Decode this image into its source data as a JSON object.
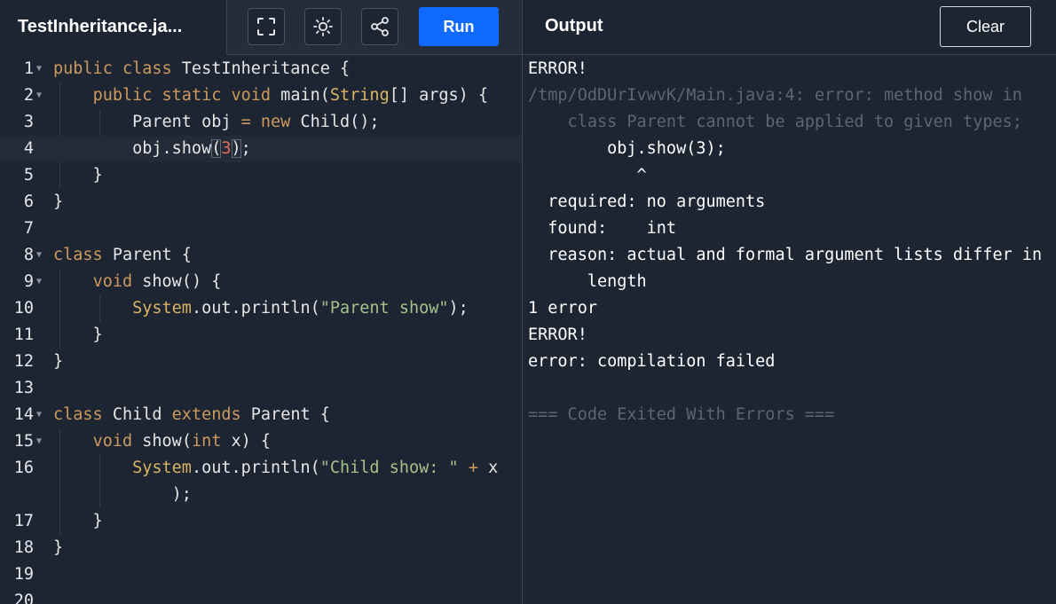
{
  "header": {
    "filename": "TestInheritance.ja...",
    "run_label": "Run",
    "output_title": "Output",
    "clear_label": "Clear",
    "icons": [
      "fullscreen-icon",
      "sun-icon",
      "share-icon"
    ]
  },
  "colors": {
    "background": "#1d2432",
    "run_button": "#0f6bff",
    "keyword": "#cc9a5d",
    "string": "#a5c28b",
    "number": "#e06c5a"
  },
  "editor": {
    "line_numbers": [
      "1",
      "2",
      "3",
      "4",
      "5",
      "6",
      "7",
      "8",
      "9",
      "10",
      "11",
      "12",
      "13",
      "14",
      "15",
      "16",
      "17",
      "18",
      "19",
      "20"
    ],
    "active_line": "4",
    "lines": [
      [
        {
          "t": "public class",
          "c": "kw"
        },
        {
          "t": " TestInheritance {"
        }
      ],
      [
        {
          "t": "    "
        },
        {
          "t": "public static void",
          "c": "kw"
        },
        {
          "t": " main("
        },
        {
          "t": "String",
          "c": "ty"
        },
        {
          "t": "[] args) {"
        }
      ],
      [
        {
          "t": "        Parent obj "
        },
        {
          "t": "=",
          "c": "kw"
        },
        {
          "t": " "
        },
        {
          "t": "new",
          "c": "kw"
        },
        {
          "t": " Child();"
        }
      ],
      [
        {
          "t": "        obj.show"
        },
        {
          "t": "(",
          "c": "br"
        },
        {
          "t": "3",
          "c": "num"
        },
        {
          "t": ")",
          "c": "br"
        },
        {
          "t": ";"
        }
      ],
      [
        {
          "t": "    }"
        }
      ],
      [
        {
          "t": "}"
        }
      ],
      [
        {
          "t": ""
        }
      ],
      [
        {
          "t": "class",
          "c": "kw"
        },
        {
          "t": " Parent {"
        }
      ],
      [
        {
          "t": "    "
        },
        {
          "t": "void",
          "c": "kw"
        },
        {
          "t": " show() {"
        }
      ],
      [
        {
          "t": "        "
        },
        {
          "t": "System",
          "c": "ty"
        },
        {
          "t": ".out.println("
        },
        {
          "t": "\"Parent show\"",
          "c": "str"
        },
        {
          "t": ");"
        }
      ],
      [
        {
          "t": "    }"
        }
      ],
      [
        {
          "t": "}"
        }
      ],
      [
        {
          "t": ""
        }
      ],
      [
        {
          "t": "class",
          "c": "kw"
        },
        {
          "t": " Child "
        },
        {
          "t": "extends",
          "c": "kw"
        },
        {
          "t": " Parent {"
        }
      ],
      [
        {
          "t": "    "
        },
        {
          "t": "void",
          "c": "kw"
        },
        {
          "t": " show("
        },
        {
          "t": "int",
          "c": "kw"
        },
        {
          "t": " x) {"
        }
      ],
      [
        {
          "t": "        "
        },
        {
          "t": "System",
          "c": "ty"
        },
        {
          "t": ".out.println("
        },
        {
          "t": "\"Child show: \"",
          "c": "str"
        },
        {
          "t": " "
        },
        {
          "t": "+",
          "c": "kw"
        },
        {
          "t": " x"
        }
      ],
      [
        {
          "t": "            );"
        }
      ],
      [
        {
          "t": "    }"
        }
      ],
      [
        {
          "t": "}"
        }
      ],
      [
        {
          "t": ""
        }
      ],
      [
        {
          "t": ""
        }
      ]
    ]
  },
  "output": {
    "lines": [
      {
        "text": "ERROR!"
      },
      {
        "text": "/tmp/OdDUrIvwvK/Main.java:4: error: method show in",
        "dim": true
      },
      {
        "text": "    class Parent cannot be applied to given types;",
        "dim": true
      },
      {
        "text": "        obj.show(3);"
      },
      {
        "text": "           ^"
      },
      {
        "text": "  required: no arguments"
      },
      {
        "text": "  found:    int"
      },
      {
        "text": "  reason: actual and formal argument lists differ in"
      },
      {
        "text": "      length"
      },
      {
        "text": "1 error"
      },
      {
        "text": "ERROR!"
      },
      {
        "text": "error: compilation failed"
      },
      {
        "text": ""
      },
      {
        "text": "=== Code Exited With Errors ===",
        "dim": true
      }
    ]
  }
}
